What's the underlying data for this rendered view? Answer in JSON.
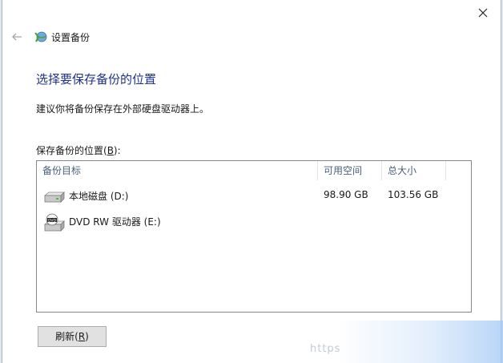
{
  "window": {
    "title": "设置备份"
  },
  "page": {
    "heading": "选择要保存备份的位置",
    "description": "建议你将备份保存在外部硬盘驱动器上。",
    "list_label": "保存备份的位置(",
    "list_label_key": "B",
    "list_label_end": "):"
  },
  "table": {
    "columns": [
      "备份目标",
      "可用空间",
      "总大小"
    ],
    "rows": [
      {
        "icon": "hard-disk-icon",
        "name": "本地磁盘 (D:)",
        "free": "98.90 GB",
        "total": "103.56 GB"
      },
      {
        "icon": "dvd-drive-icon",
        "name": "DVD RW 驱动器 (E:)",
        "free": "",
        "total": ""
      }
    ]
  },
  "buttons": {
    "refresh_label": "刷新(",
    "refresh_key": "R",
    "refresh_end": ")"
  },
  "watermark": "https"
}
